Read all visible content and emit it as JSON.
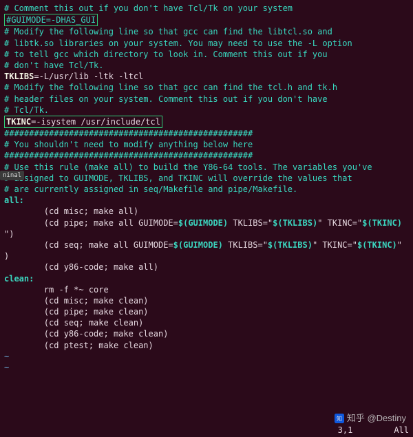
{
  "tab_label": "ninal",
  "lines": [
    {
      "segs": [
        {
          "cls": "cmt",
          "t": "# Comment this out if you don't have Tcl/Tk on your system"
        }
      ]
    },
    {
      "segs": [
        {
          "cls": "txt",
          "t": ""
        }
      ]
    },
    {
      "box": true,
      "segs": [
        {
          "cls": "cmt",
          "t": "#GUIMODE=-DHAS_GUI"
        }
      ]
    },
    {
      "segs": [
        {
          "cls": "txt",
          "t": ""
        }
      ]
    },
    {
      "segs": [
        {
          "cls": "cmt",
          "t": "# Modify the following line so that gcc can find the libtcl.so and"
        }
      ]
    },
    {
      "segs": [
        {
          "cls": "cmt",
          "t": "# libtk.so libraries on your system. You may need to use the -L option"
        }
      ]
    },
    {
      "segs": [
        {
          "cls": "cmt",
          "t": "# to tell gcc which directory to look in. Comment this out if you"
        }
      ]
    },
    {
      "segs": [
        {
          "cls": "cmt",
          "t": "# don't have Tcl/Tk."
        }
      ]
    },
    {
      "segs": [
        {
          "cls": "txt",
          "t": ""
        }
      ]
    },
    {
      "segs": [
        {
          "cls": "var",
          "t": "TKLIBS"
        },
        {
          "cls": "txt",
          "t": "=-L/usr/lib -ltk -ltcl"
        }
      ]
    },
    {
      "segs": [
        {
          "cls": "txt",
          "t": ""
        }
      ]
    },
    {
      "segs": [
        {
          "cls": "cmt",
          "t": "# Modify the following line so that gcc can find the tcl.h and tk.h"
        }
      ]
    },
    {
      "segs": [
        {
          "cls": "cmt",
          "t": "# header files on your system. Comment this out if you don't have"
        }
      ]
    },
    {
      "segs": [
        {
          "cls": "cmt",
          "t": "# Tcl/Tk."
        }
      ]
    },
    {
      "segs": [
        {
          "cls": "txt",
          "t": ""
        }
      ]
    },
    {
      "box": true,
      "segs": [
        {
          "cls": "var",
          "t": "TKINC"
        },
        {
          "cls": "txt",
          "t": "=-isystem /usr/include/tcl"
        }
      ]
    },
    {
      "segs": [
        {
          "cls": "txt",
          "t": ""
        }
      ]
    },
    {
      "segs": [
        {
          "cls": "cmt",
          "t": "##################################################"
        }
      ]
    },
    {
      "segs": [
        {
          "cls": "cmt",
          "t": "# You shouldn't need to modify anything below here"
        }
      ]
    },
    {
      "segs": [
        {
          "cls": "cmt",
          "t": "##################################################"
        }
      ]
    },
    {
      "segs": [
        {
          "cls": "txt",
          "t": ""
        }
      ]
    },
    {
      "segs": [
        {
          "cls": "cmt",
          "t": "# Use this rule (make all) to build the Y86-64 tools. The variables you've"
        }
      ]
    },
    {
      "segs": [
        {
          "cls": "cmt",
          "t": "# assigned to GUIMODE, TKLIBS, and TKINC will override the values that"
        }
      ]
    },
    {
      "segs": [
        {
          "cls": "cmt",
          "t": "# are currently assigned in seq/Makefile and pipe/Makefile."
        }
      ]
    },
    {
      "segs": [
        {
          "cls": "tgt",
          "t": "all:"
        }
      ]
    },
    {
      "segs": [
        {
          "cls": "txt",
          "t": "        (cd misc; make all)"
        }
      ]
    },
    {
      "segs": [
        {
          "cls": "txt",
          "t": "        (cd pipe; make all GUIMODE="
        },
        {
          "cls": "exp",
          "t": "$(GUIMODE)"
        },
        {
          "cls": "txt",
          "t": " TKLIBS=\""
        },
        {
          "cls": "exp",
          "t": "$(TKLIBS)"
        },
        {
          "cls": "txt",
          "t": "\" TKINC=\""
        },
        {
          "cls": "exp",
          "t": "$(TKINC)"
        }
      ]
    },
    {
      "segs": [
        {
          "cls": "txt",
          "t": "\")"
        }
      ]
    },
    {
      "segs": [
        {
          "cls": "txt",
          "t": "        (cd seq; make all GUIMODE="
        },
        {
          "cls": "exp",
          "t": "$(GUIMODE)"
        },
        {
          "cls": "txt",
          "t": " TKLIBS=\""
        },
        {
          "cls": "exp",
          "t": "$(TKLIBS)"
        },
        {
          "cls": "txt",
          "t": "\" TKINC=\""
        },
        {
          "cls": "exp",
          "t": "$(TKINC)"
        },
        {
          "cls": "txt",
          "t": "\""
        }
      ]
    },
    {
      "segs": [
        {
          "cls": "txt",
          "t": ")"
        }
      ]
    },
    {
      "segs": [
        {
          "cls": "txt",
          "t": "        (cd y86-code; make all)"
        }
      ]
    },
    {
      "segs": [
        {
          "cls": "txt",
          "t": ""
        }
      ]
    },
    {
      "segs": [
        {
          "cls": "tgt",
          "t": "clean:"
        }
      ]
    },
    {
      "segs": [
        {
          "cls": "txt",
          "t": "        rm -f *~ core"
        }
      ]
    },
    {
      "segs": [
        {
          "cls": "txt",
          "t": "        (cd misc; make clean)"
        }
      ]
    },
    {
      "segs": [
        {
          "cls": "txt",
          "t": "        (cd pipe; make clean)"
        }
      ]
    },
    {
      "segs": [
        {
          "cls": "txt",
          "t": "        (cd seq; make clean)"
        }
      ]
    },
    {
      "segs": [
        {
          "cls": "txt",
          "t": "        (cd y86-code; make clean)"
        }
      ]
    },
    {
      "segs": [
        {
          "cls": "txt",
          "t": "        (cd ptest; make clean)"
        }
      ]
    },
    {
      "segs": [
        {
          "cls": "txt",
          "t": ""
        }
      ]
    },
    {
      "segs": [
        {
          "cls": "tilde",
          "t": "~"
        }
      ]
    },
    {
      "segs": [
        {
          "cls": "tilde",
          "t": "~"
        }
      ]
    }
  ],
  "status": {
    "pos": "3,1",
    "scroll": "All"
  },
  "watermark": {
    "site": "知乎",
    "author": "@Destiny"
  }
}
